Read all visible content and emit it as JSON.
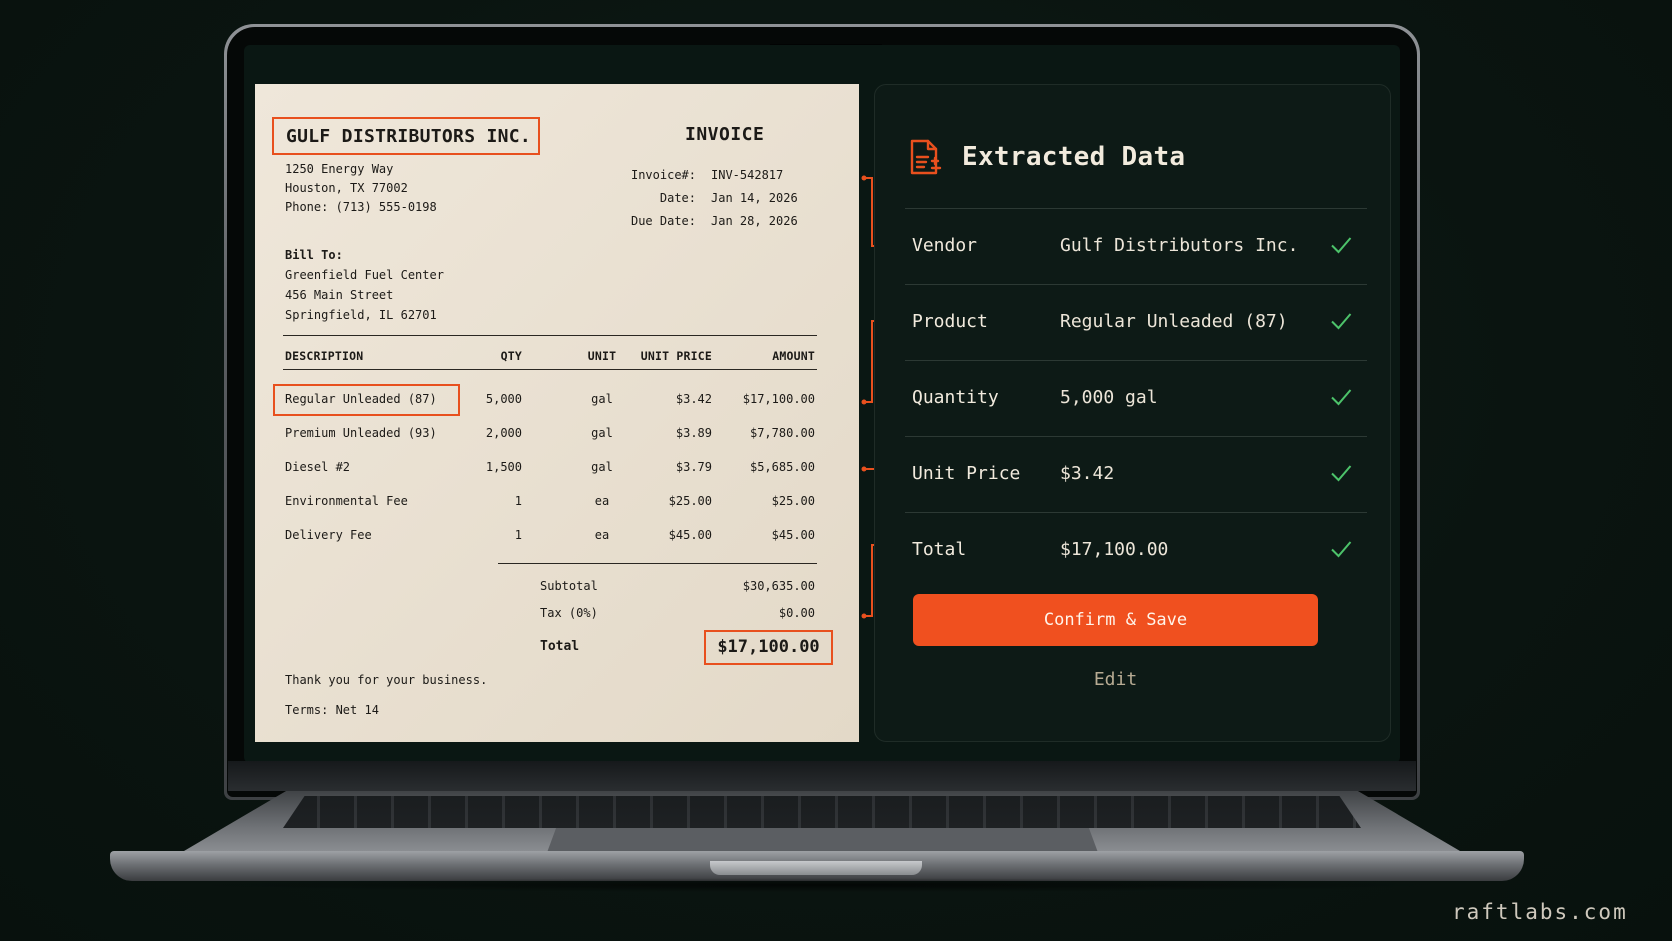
{
  "invoice": {
    "vendor_name": "GULF DISTRIBUTORS INC.",
    "vendor_address": [
      "1250 Energy Way",
      "Houston, TX 77002",
      "Phone: (713) 555-0198"
    ],
    "title": "INVOICE",
    "meta": [
      {
        "label": "Invoice#:",
        "value": "INV-542817"
      },
      {
        "label": "Date:",
        "value": "Jan 14, 2026"
      },
      {
        "label": "Due Date:",
        "value": "Jan 28, 2026"
      }
    ],
    "bill_to_heading": "Bill To:",
    "bill_to": [
      "Greenfield Fuel Center",
      "456 Main Street",
      "Springfield, IL 62701"
    ],
    "columns": {
      "description": "DESCRIPTION",
      "qty": "QTY",
      "unit": "UNIT",
      "unit_price": "UNIT PRICE",
      "amount": "AMOUNT"
    },
    "items": [
      {
        "description": "Regular Unleaded (87)",
        "qty": "5,000",
        "unit": "gal",
        "unit_price": "$3.42",
        "amount": "$17,100.00"
      },
      {
        "description": "Premium Unleaded (93)",
        "qty": "2,000",
        "unit": "gal",
        "unit_price": "$3.89",
        "amount": "$7,780.00"
      },
      {
        "description": "Diesel #2",
        "qty": "1,500",
        "unit": "gal",
        "unit_price": "$3.79",
        "amount": "$5,685.00"
      },
      {
        "description": "Environmental Fee",
        "qty": "1",
        "unit": "ea",
        "unit_price": "$25.00",
        "amount": "$25.00"
      },
      {
        "description": "Delivery Fee",
        "qty": "1",
        "unit": "ea",
        "unit_price": "$45.00",
        "amount": "$45.00"
      }
    ],
    "subtotal_label": "Subtotal",
    "subtotal_value": "$30,635.00",
    "tax_label": "Tax (0%)",
    "tax_value": "$0.00",
    "total_label": "Total",
    "total_value": "$17,100.00",
    "thanks": "Thank you for your business.",
    "terms": "Terms: Net 14"
  },
  "panel": {
    "title": "Extracted Data",
    "fields": [
      {
        "label": "Vendor",
        "value": "Gulf Distributors Inc."
      },
      {
        "label": "Product",
        "value": "Regular Unleaded (87)"
      },
      {
        "label": "Quantity",
        "value": "5,000 gal"
      },
      {
        "label": "Unit Price",
        "value": "$3.42"
      },
      {
        "label": "Total",
        "value": "$17,100.00"
      }
    ],
    "confirm_label": "Confirm & Save",
    "edit_label": "Edit"
  },
  "watermark": "raftlabs.com",
  "colors": {
    "accent": "#f0501f",
    "check": "#4cc36a",
    "paper": "#ece4d6",
    "panel_bg": "#0d1a16"
  }
}
